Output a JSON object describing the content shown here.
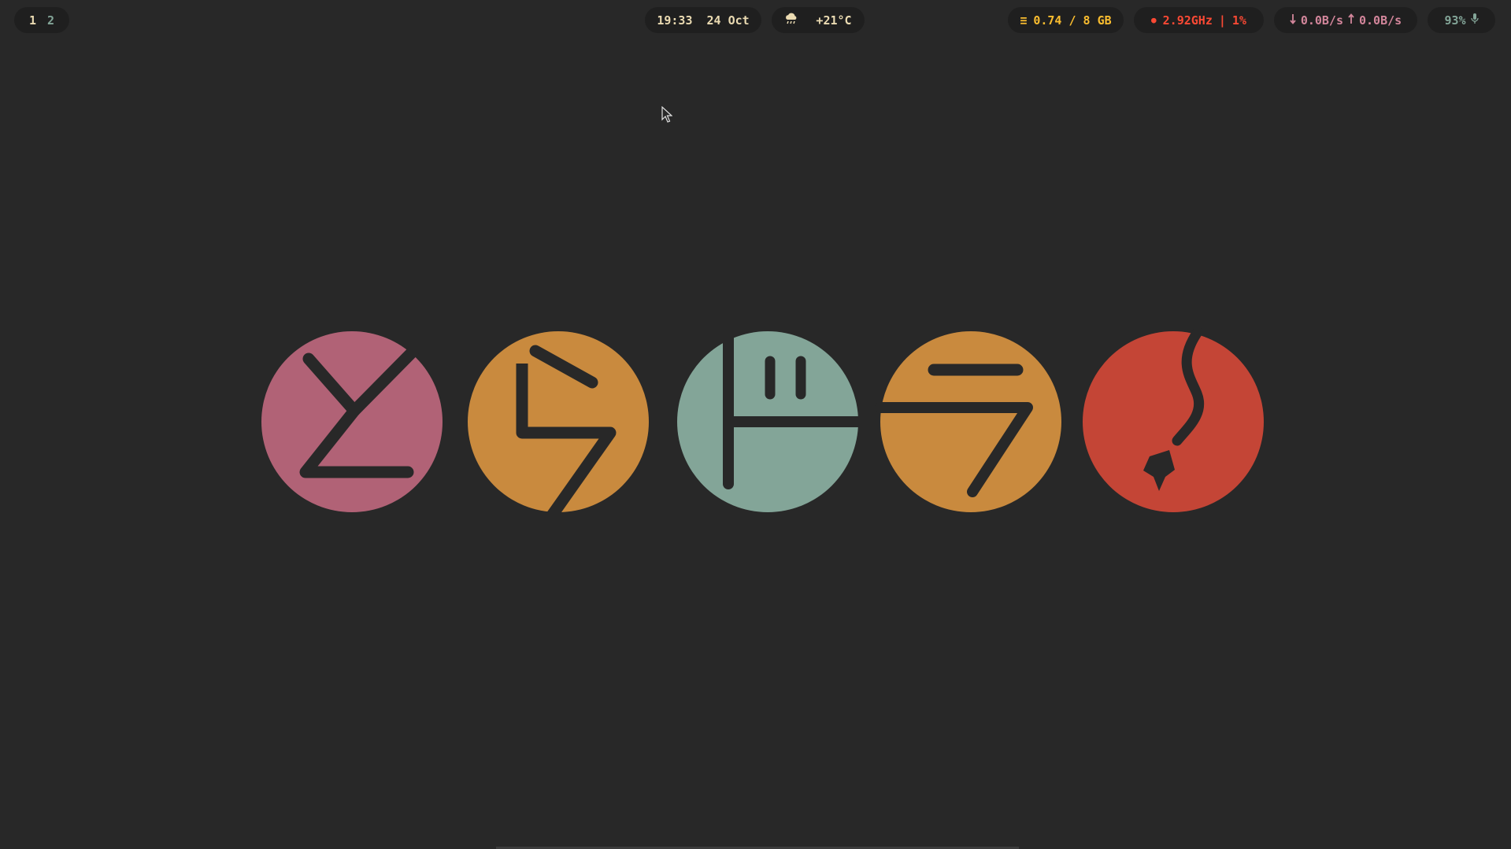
{
  "workspaces": [
    {
      "label": "1",
      "active": true
    },
    {
      "label": "2",
      "active": false
    }
  ],
  "clock": {
    "time": "19:33",
    "date": "24 Oct"
  },
  "weather": {
    "icon": "cloud-rain-icon",
    "temperature": "+21°C"
  },
  "memory": {
    "icon": "memory-icon",
    "glyph": "≡",
    "usage": "0.74 / 8 GB"
  },
  "cpu": {
    "icon": "cpu-icon",
    "glyph": "●",
    "frequency": "2.92GHz",
    "separator": "|",
    "load": "1%"
  },
  "network": {
    "down_icon": "arrow-down-icon",
    "down": "0.0B/s",
    "up_icon": "arrow-up-icon",
    "up": "0.0B/s"
  },
  "microphone": {
    "volume": "93%",
    "icon": "microphone-icon"
  },
  "colors": {
    "background": "#282828",
    "pill": "#1f1f1f",
    "pink": "#b16276",
    "orange": "#c98a3e",
    "teal": "#83a598",
    "red": "#c44536",
    "stroke": "#282828"
  }
}
